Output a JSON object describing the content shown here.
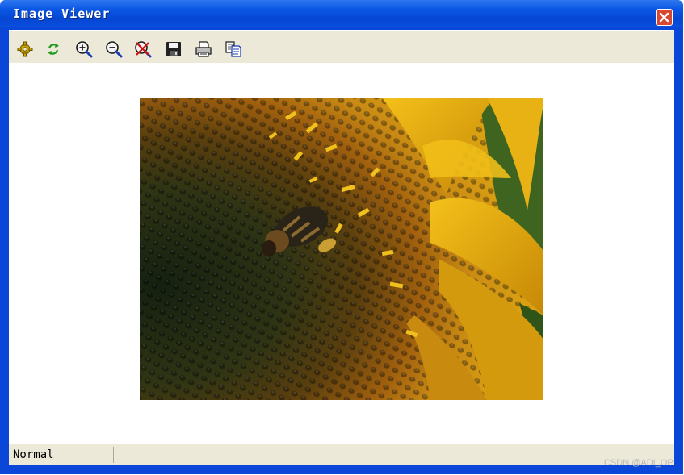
{
  "window": {
    "title": "Image Viewer",
    "close_icon": "close-x-icon"
  },
  "toolbar": {
    "buttons": [
      {
        "name": "settings",
        "icon": "gear-icon"
      },
      {
        "name": "refresh",
        "icon": "refresh-arrows-icon"
      },
      {
        "name": "zoom-in",
        "icon": "zoom-in-icon"
      },
      {
        "name": "zoom-out",
        "icon": "zoom-out-icon"
      },
      {
        "name": "zoom-reset",
        "icon": "zoom-cancel-icon"
      },
      {
        "name": "save",
        "icon": "floppy-disk-icon"
      },
      {
        "name": "print",
        "icon": "printer-icon"
      },
      {
        "name": "copy",
        "icon": "copy-icon"
      }
    ]
  },
  "image": {
    "subject": "photo",
    "content_icon": "photo-sunflower-bee"
  },
  "status": {
    "mode": "Normal"
  },
  "watermark": {
    "text": "CSDN @ADI_OP"
  },
  "colors": {
    "titlebar": "#0a56e4",
    "toolbar_bg": "#ece9d8",
    "close_button": "#d8472f"
  }
}
